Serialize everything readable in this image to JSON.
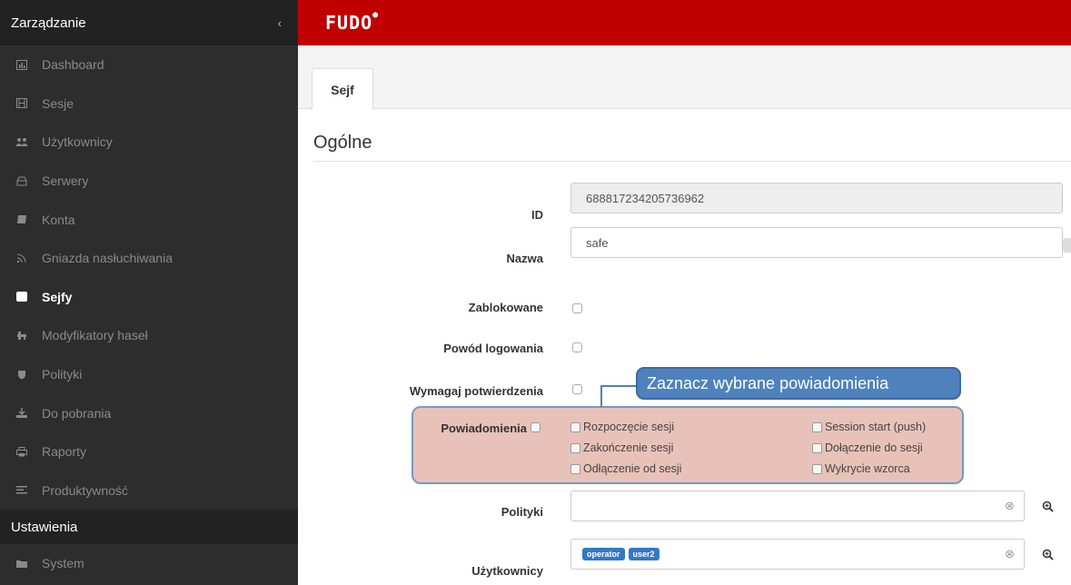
{
  "sidebar": {
    "header": "Zarządzanie",
    "items": [
      {
        "label": "Dashboard",
        "icon": "chart-icon"
      },
      {
        "label": "Sesje",
        "icon": "film-icon"
      },
      {
        "label": "Użytkownicy",
        "icon": "users-icon"
      },
      {
        "label": "Serwery",
        "icon": "server-icon"
      },
      {
        "label": "Konta",
        "icon": "account-icon"
      },
      {
        "label": "Gniazda nasłuchiwania",
        "icon": "rss-icon"
      },
      {
        "label": "Sejfy",
        "icon": "safe-icon"
      },
      {
        "label": "Modyfikatory haseł",
        "icon": "modifier-icon"
      },
      {
        "label": "Polityki",
        "icon": "shield-icon"
      },
      {
        "label": "Do pobrania",
        "icon": "download-icon"
      },
      {
        "label": "Raporty",
        "icon": "print-icon"
      },
      {
        "label": "Produktywność",
        "icon": "list-icon"
      }
    ],
    "section": "Ustawienia",
    "bottom_item": {
      "label": "System",
      "icon": "folder-icon"
    }
  },
  "topbar": {
    "logo": "FUDO"
  },
  "tabs": [
    {
      "label": "Sejf"
    }
  ],
  "section_title": "Ogólne",
  "form": {
    "id_label": "ID",
    "id_value": "688817234205736962",
    "name_label": "Nazwa",
    "name_value": "safe",
    "blocked_label": "Zablokowane",
    "reason_label": "Powód logowania",
    "confirm_label": "Wymagaj potwierdzenia",
    "notifications_label": "Powiadomienia",
    "notification_options": [
      "Rozpoczęcie sesji",
      "Zakończenie sesji",
      "Odłączenie od sesji",
      "Session start (push)",
      "Dołączenie do sesji",
      "Wykrycie wzorca"
    ],
    "policies_label": "Polityki",
    "users_label": "Użytkownicy",
    "users_tags": [
      "operator",
      "user2"
    ]
  },
  "callout": "Zaznacz wybrane powiadomienia",
  "colors": {
    "brand_red": "#c00000",
    "sidebar_bg": "#2d2d2d",
    "callout_blue": "#4f82bc",
    "highlight_fill": "#e8c2b8",
    "tag_blue": "#3478c6"
  }
}
